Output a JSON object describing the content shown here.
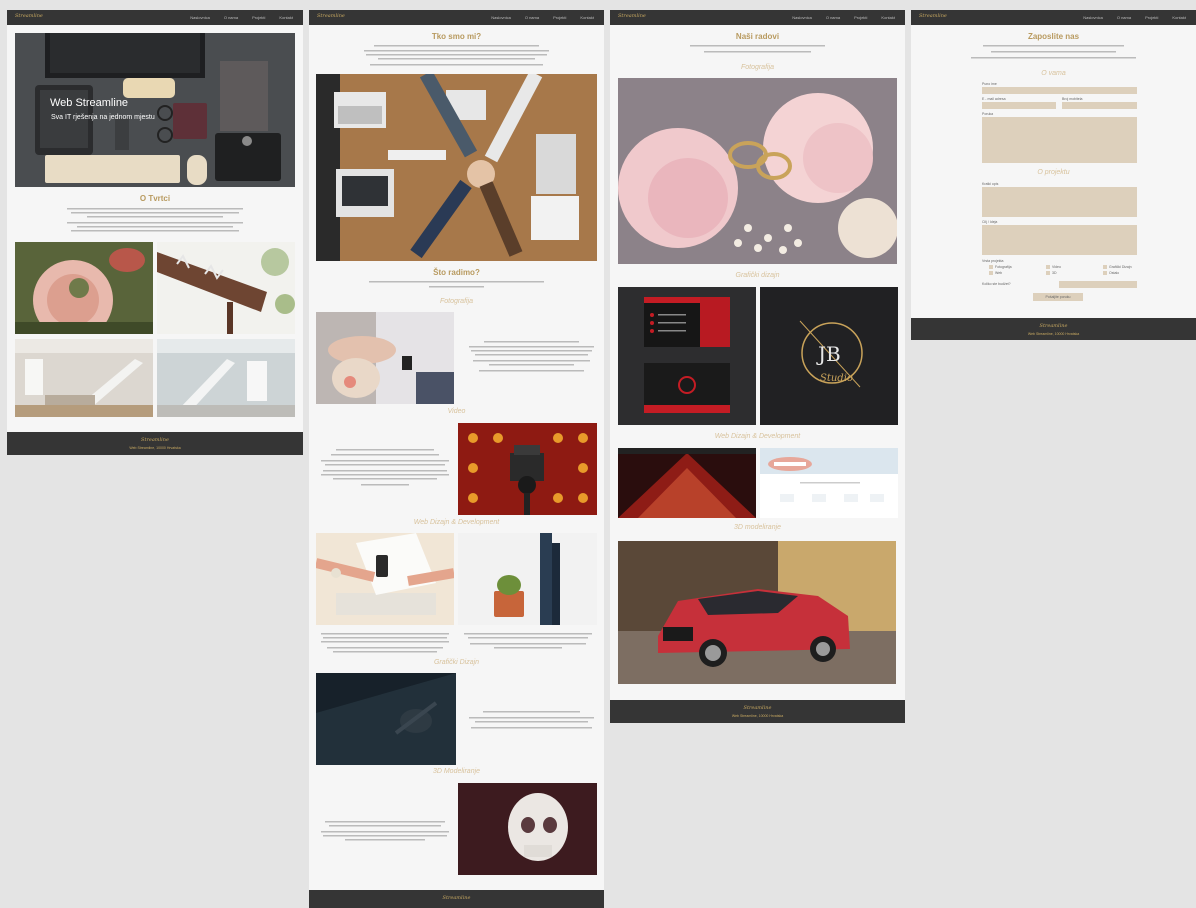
{
  "nav": {
    "logo": "Streamline",
    "items": [
      "Naslovnica",
      "O nama",
      "Projekti",
      "Kontakt"
    ]
  },
  "footer": {
    "logo": "Streamline",
    "text": "Web Streamline, 10000 Hrvatska"
  },
  "home": {
    "hero_title": "Web Streamline",
    "hero_subtitle": "Sva IT rješenja na jednom mjestu",
    "section_title": "O Tvrtci"
  },
  "about": {
    "title1": "Tko smo mi?",
    "title2": "Što radimo?",
    "sections": [
      "Fotografija",
      "Video",
      "Web Dizajn & Development",
      "Grafički Dizajn",
      "3D Modeliranje"
    ]
  },
  "works": {
    "title": "Naši radovi",
    "sections": [
      "Fotografija",
      "Grafički dizajn",
      "Web Dizajn & Development",
      "3D modeliranje"
    ],
    "logo_mark": "JB",
    "logo_script": "Studio"
  },
  "contact": {
    "title": "Zaposlite nas",
    "section1": "O vama",
    "section2": "O projektu",
    "labels": {
      "name": "Puno ime",
      "email": "E - mail adresa",
      "phone": "Broj mobitela",
      "message": "Poruka",
      "short_desc": "Kratki opis",
      "goal": "Cilj / Ideja",
      "type": "Vrsta projekta",
      "budget": "Koliko ste budžet?"
    },
    "types": [
      "Fotografija",
      "Video",
      "Grafički Dizajn",
      "Web",
      "3D",
      "Ostalo"
    ],
    "submit": "Pošaljite poruku"
  }
}
